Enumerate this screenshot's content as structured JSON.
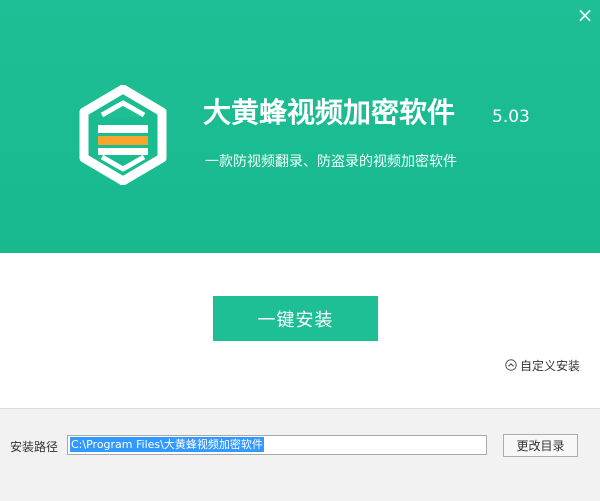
{
  "window": {
    "close_glyph": "×"
  },
  "header": {
    "logo_icon": "hexagon-shield-logo",
    "title": "大黄蜂视频加密软件",
    "version": "5.03",
    "subtitle": "一款防视频翻录、防盗录的视频加密软件",
    "bg_color": "#1fbf96",
    "logo_accent_color": "#f7a42a"
  },
  "main": {
    "install_button_label": "一键安装",
    "custom_install_label": "自定义安装",
    "custom_install_icon": "chevron-up-circle-icon"
  },
  "footer": {
    "path_label": "安装路径",
    "path_value": "C:\\Program Files\\大黄蜂视频加密软件",
    "browse_button_label": "更改目录"
  }
}
